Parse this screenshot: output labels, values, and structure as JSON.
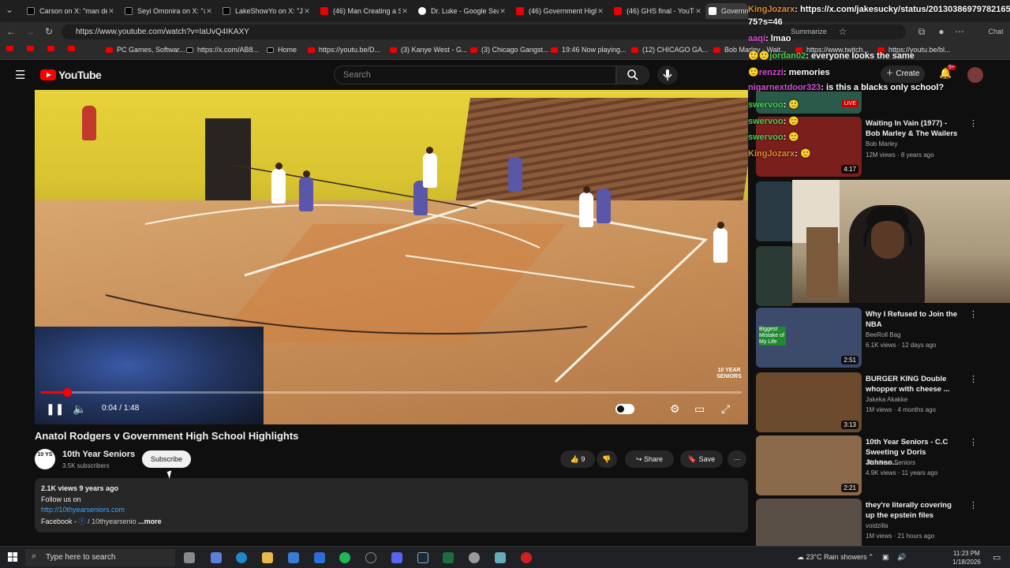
{
  "tabs": [
    {
      "title": "Carson on X: \"man dey",
      "icon": "x"
    },
    {
      "title": "Seyi Omonira on X: \"@D",
      "icon": "x"
    },
    {
      "title": "LakeShowYo on X: \"Ja M",
      "icon": "x"
    },
    {
      "title": "(46) Man Creating a Sce",
      "icon": "yt"
    },
    {
      "title": "Dr. Luke - Google Search",
      "icon": "g"
    },
    {
      "title": "(46) Government High S",
      "icon": "yt"
    },
    {
      "title": "(46) GHS final - YouTube",
      "icon": "yt"
    },
    {
      "title": "Governme",
      "icon": "w"
    }
  ],
  "browser": {
    "url": "https://www.youtube.com/watch?v=IaUvQ4IKAXY",
    "summarize": "Summarize",
    "chat_label": "Chat"
  },
  "bookmarks": [
    {
      "label": "",
      "icon": "yt"
    },
    {
      "label": "",
      "icon": "yt"
    },
    {
      "label": "",
      "icon": "yt"
    },
    {
      "label": "PC Games, Softwar...",
      "icon": "yt"
    },
    {
      "label": "https://x.com/AB8...",
      "icon": "x"
    },
    {
      "label": "Home",
      "icon": "x"
    },
    {
      "label": "https://youtu.be/D...",
      "icon": "yt"
    },
    {
      "label": "(3) Kanye West - G...",
      "icon": "yt"
    },
    {
      "label": "(3) Chicago Gangst...",
      "icon": "yt"
    },
    {
      "label": "19:46 Now playing...",
      "icon": "yt"
    },
    {
      "label": "(12) CHICAGO GA...",
      "icon": "yt"
    },
    {
      "label": "Bob Marley - Wait...",
      "icon": "yt"
    },
    {
      "label": "https://www.twitch...",
      "icon": "yt"
    },
    {
      "label": "https://youtu.be/bl...",
      "icon": "yt"
    }
  ],
  "youtube": {
    "logo": "YouTube",
    "search_placeholder": "Search",
    "create": "Create",
    "notif_badge": "9+"
  },
  "video": {
    "current_time": "0:04",
    "duration": "1:48",
    "progress": 0.037,
    "watermark": "10 YEAR SENIORS",
    "title": "Anatol Rodgers v Government High School Highlights"
  },
  "channel": {
    "avatar_text": "10 YS",
    "name": "10th Year Seniors",
    "subs": "3.5K subscribers",
    "subscribe": "Subscribe"
  },
  "actions": {
    "likes": "9",
    "share": "Share",
    "save": "Save"
  },
  "description": {
    "meta": "2.1K views  9 years ago",
    "line1": "Follow us on",
    "link": "http://10thyearseniors.com",
    "facebook": "Facebook - ",
    "facebook_handle": "/ 10thyearsenio",
    "more": "...more"
  },
  "recommendations": [
    {
      "title": "Waiting In Vain (1977) - Bob Marley & The Wailers",
      "channel": "Bob Marley",
      "meta": "12M views · 8 years ago",
      "duration": "4:17",
      "thumb": "#7a1f1c"
    },
    {
      "title": "Why I Refused to Join the NBA",
      "channel": "BeeRoll Bag",
      "meta": "6.1K views · 12 days ago",
      "duration": "2:51",
      "thumb": "#3c4a6b",
      "thumb_text": "Biggest Mistake of My Life"
    },
    {
      "title": "BURGER KING Double whopper with cheese ...",
      "channel": "Jakeka Akakke",
      "meta": "1M views · 4 months ago",
      "duration": "3:13",
      "thumb": "#6b4a2e"
    },
    {
      "title": "10th Year Seniors - C.C Sweeting v Doris Johnso...",
      "channel": "10th Year Seniors",
      "meta": "4.9K views · 11 years ago",
      "duration": "2:21",
      "thumb": "#8a6a4a"
    },
    {
      "title": "they're literally covering up the epstein files",
      "channel": "voidzilla",
      "meta": "1M views · 21 hours ago",
      "duration": "",
      "thumb": "#5a4f47"
    }
  ],
  "chat": [
    {
      "user": "KingJozarx",
      "text": "https://x.com/jakesucky/status/20130386979782165",
      "color": "orange"
    },
    {
      "user": "",
      "text": "75?s=46",
      "color": "orange"
    },
    {
      "user": "aaqi",
      "text": "lmao",
      "color": "white"
    },
    {
      "user": "jordan02",
      "text": "everyone looks the same",
      "color": "green"
    },
    {
      "user": "renzzi",
      "text": "memories",
      "color": "pink"
    },
    {
      "user": "nigarnextdoor323",
      "text": "is this a blacks only school?",
      "color": "pink"
    },
    {
      "user": "swervoo",
      "text": "",
      "color": "green"
    },
    {
      "user": "swervoo",
      "text": "",
      "color": "green"
    },
    {
      "user": "swervoo",
      "text": "",
      "color": "green"
    },
    {
      "user": "KingJozarx",
      "text": "",
      "color": "orange"
    }
  ],
  "live_badge": "LIVE",
  "taskbar": {
    "search": "Type here to search",
    "weather": "23°C  Rain showers",
    "time": "11:23 PM",
    "date": "1/18/2026"
  }
}
